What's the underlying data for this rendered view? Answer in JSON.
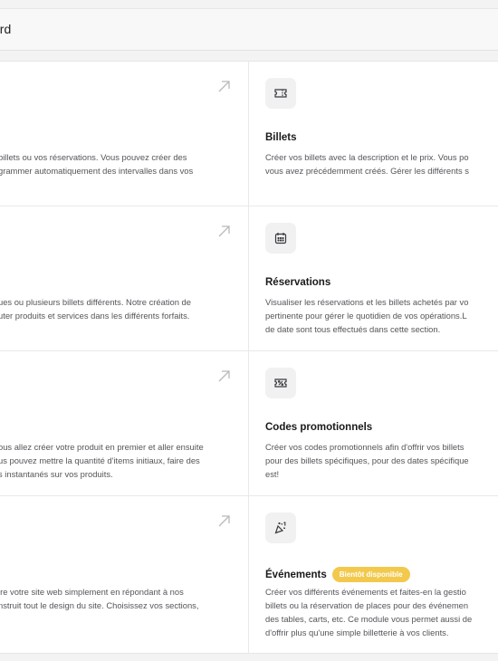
{
  "header": {
    "title": "ord"
  },
  "rows": [
    {
      "left": {
        "desc_lines": [
          "billets ou vos réservations. Vous pouvez créer des",
          "grammer automatiquement des intervalles dans vos"
        ]
      },
      "right": {
        "icon": "ticket-icon",
        "title": "Billets",
        "desc_lines": [
          "Créer vos billets avec la description et le prix. Vous po",
          "vous avez précédemment créés. Gérer les différents s"
        ]
      }
    },
    {
      "left": {
        "desc_lines": [
          "ues ou plusieurs billets différents. Notre création de",
          "uter produits et services dans les différents forfaits."
        ]
      },
      "right": {
        "icon": "calendar-icon",
        "title": "Réservations",
        "desc_lines": [
          "Visualiser les réservations et les billets achetés par vo",
          "pertinente pour gérer le quotidien de vos opérations.L",
          "de date sont tous effectués dans cette section."
        ]
      }
    },
    {
      "left": {
        "desc_lines": [
          "ous allez créer votre produit en premier et aller ensuite",
          "us pouvez mettre la quantité d'items initiaux, faire des",
          "s instantanés sur vos produits."
        ]
      },
      "right": {
        "icon": "discount-ticket-icon",
        "title": "Codes promotionnels",
        "desc_lines": [
          "Créer vos codes promotionnels afin d'offrir vos billets",
          "pour des billets spécifiques, pour des dates spécifique",
          "est!"
        ]
      }
    },
    {
      "left": {
        "desc_lines": [
          "ire votre site web simplement en répondant à nos",
          "nstruit tout le design du site. Choisissez vos sections,"
        ]
      },
      "right": {
        "icon": "party-popper-icon",
        "title": "Événements",
        "badge": "Bientôt disponible",
        "desc_lines": [
          "Créer vos différents événements et faites-en la gestio",
          "billets ou la réservation de places pour des événemen",
          "des tables, carts, etc. Ce module vous permet aussi de",
          "d'offrir plus qu'une simple billetterie à vos clients."
        ]
      }
    }
  ],
  "colors": {
    "badge": "#f2c94c",
    "icon_bg": "#f1f1f2"
  }
}
